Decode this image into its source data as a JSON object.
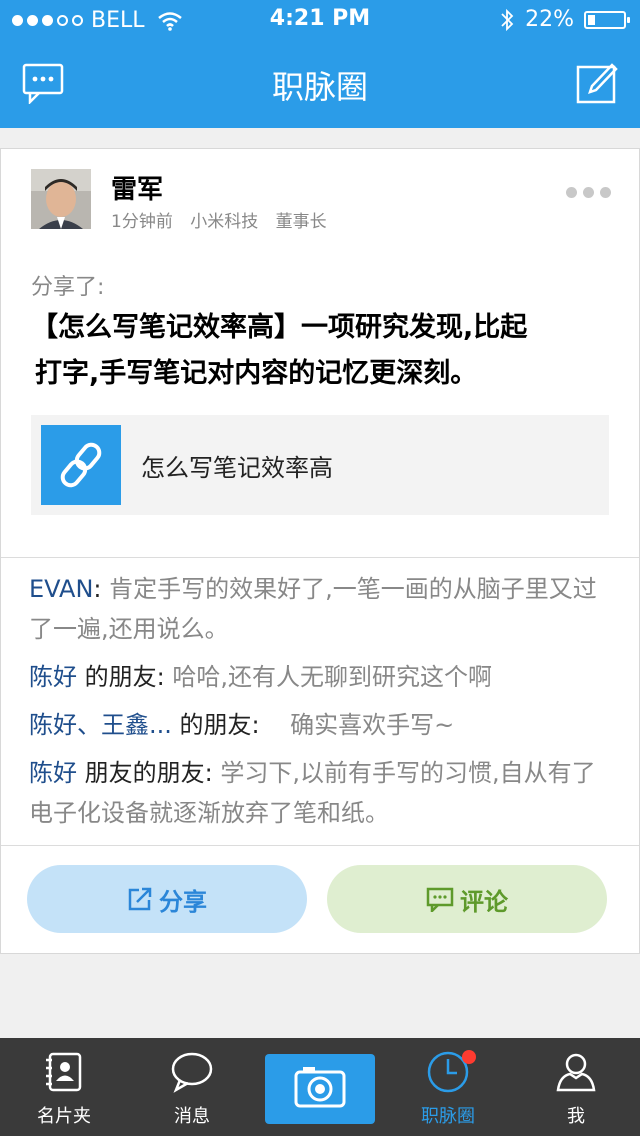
{
  "status_bar": {
    "carrier": "BELL",
    "time": "4:21 PM",
    "battery": "22%",
    "battery_level": 0.22
  },
  "nav": {
    "title": "职脉圈",
    "left_icon": "chat-bubble-icon",
    "right_icon": "compose-icon"
  },
  "post": {
    "author": "雷军",
    "time_ago": "1分钟前",
    "company": "小米科技",
    "position": "董事长",
    "shared_label": "分享了:",
    "headline_line1": "【怎么写笔记效率高】一项研究发现,比起",
    "headline_line2": "打字,手写笔记对内容的记忆更深刻。",
    "link_title": "怎么写笔记效率高",
    "link_icon": "link-chain-icon"
  },
  "comments": [
    {
      "user": "EVAN",
      "relation": "",
      "text": "肯定手写的效果好了,一笔一画的从脑子里又过了一遍,还用说么。"
    },
    {
      "user": "陈好",
      "relation": " 的朋友",
      "text": "哈哈,还有人无聊到研究这个啊"
    },
    {
      "user": "陈好、王鑫...",
      "relation": " 的朋友",
      "text": "   确实喜欢手写~"
    },
    {
      "user": "陈好",
      "relation": " 朋友的朋友",
      "text": "   学习下,以前有手写的习惯,自从有了电子化设备就逐渐放弃了笔和纸。"
    }
  ],
  "actions": {
    "share_label": "分享",
    "comment_label": "评论"
  },
  "tabbar": {
    "items": [
      {
        "label": "名片夹",
        "icon": "contact-card-icon"
      },
      {
        "label": "消息",
        "icon": "message-bubble-icon"
      },
      {
        "label": "",
        "icon": "camera-icon"
      },
      {
        "label": "职脉圈",
        "icon": "clock-icon"
      },
      {
        "label": "我",
        "icon": "person-icon"
      }
    ]
  },
  "colors": {
    "brand": "#2b9ce8",
    "share_bg": "#c4e2f8",
    "comment_bg": "#dfeed0",
    "comment_user": "#1f4e8c",
    "badge": "#ff3b30"
  }
}
